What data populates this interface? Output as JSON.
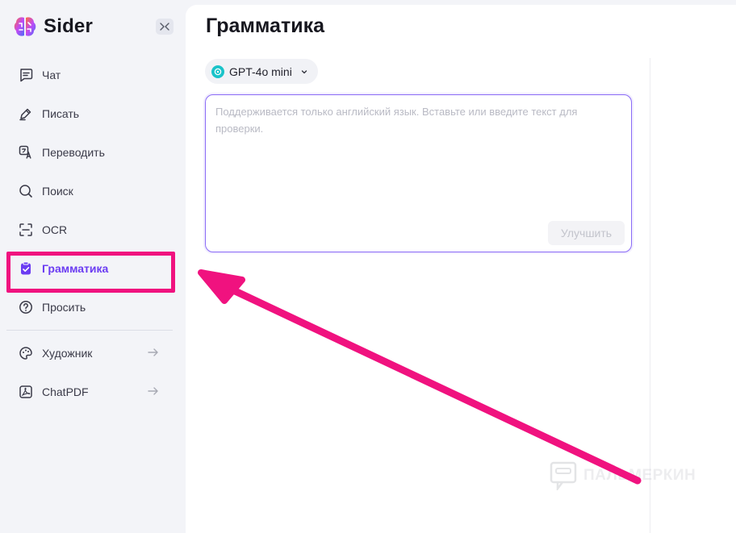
{
  "brand": {
    "name": "Sider"
  },
  "sidebar": {
    "items": [
      {
        "label": "Чат",
        "icon": "chat-icon"
      },
      {
        "label": "Писать",
        "icon": "pen-icon"
      },
      {
        "label": "Переводить",
        "icon": "translate-icon"
      },
      {
        "label": "Поиск",
        "icon": "search-icon"
      },
      {
        "label": "OCR",
        "icon": "ocr-scan-icon"
      },
      {
        "label": "Грамматика",
        "icon": "grammar-clipboard-icon",
        "active": true
      },
      {
        "label": "Просить",
        "icon": "help-icon"
      }
    ],
    "tools": [
      {
        "label": "Художник",
        "icon": "palette-icon"
      },
      {
        "label": "ChatPDF",
        "icon": "pdf-icon"
      }
    ]
  },
  "main": {
    "title": "Грамматика",
    "model": "GPT-4o mini",
    "editor_placeholder": "Поддерживается только английский язык. Вставьте или введите текст для проверки.",
    "improve_label": "Улучшить"
  },
  "watermark": "ПАЛЬМЕРКИН",
  "colors": {
    "accent": "#6b3cf2",
    "annotation": "#f0127f",
    "sidebar_bg": "#f3f4f8",
    "model_icon": "#19c3c9"
  }
}
